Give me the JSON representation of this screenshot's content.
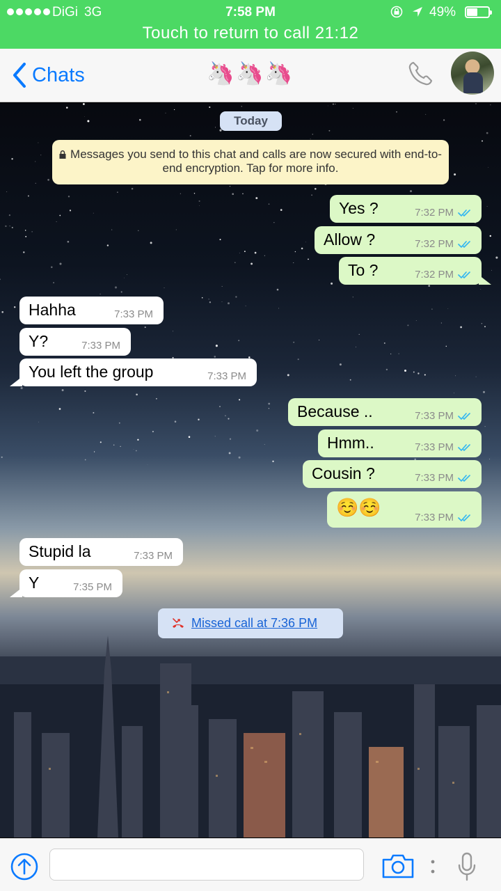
{
  "status_bar": {
    "carrier": "DiGi",
    "network": "3G",
    "time": "7:58 PM",
    "battery": "49%",
    "battery_level": 0.49
  },
  "call_banner": "Touch to return to call 21:12",
  "nav": {
    "back_label": "Chats",
    "title": "🦄🦄🦄"
  },
  "date_pill": "Today",
  "encryption_notice": "Messages you send to this chat and calls are now secured with end-to-end encryption. Tap for more info.",
  "messages": [
    {
      "dir": "out",
      "text": "Yes ?",
      "time": "7:32 PM"
    },
    {
      "dir": "out",
      "text": "Allow ?",
      "time": "7:32 PM"
    },
    {
      "dir": "out",
      "text": "To ?",
      "time": "7:32 PM"
    },
    {
      "dir": "in",
      "text": "Hahha",
      "time": "7:33 PM"
    },
    {
      "dir": "in",
      "text": "Y?",
      "time": "7:33 PM"
    },
    {
      "dir": "in",
      "text": "You left the group",
      "time": "7:33 PM"
    },
    {
      "dir": "out",
      "text": "Because ..",
      "time": "7:33 PM"
    },
    {
      "dir": "out",
      "text": "Hmm..",
      "time": "7:33 PM"
    },
    {
      "dir": "out",
      "text": "Cousin ?",
      "time": "7:33 PM"
    },
    {
      "dir": "out",
      "text": "☺️☺️",
      "time": "7:33 PM"
    },
    {
      "dir": "in",
      "text": "Stupid la",
      "time": "7:33 PM"
    },
    {
      "dir": "in",
      "text": "Y",
      "time": "7:35 PM"
    }
  ],
  "missed_call": "Missed call at 7:36 PM",
  "colors": {
    "accent": "#0a7aff",
    "call_bar": "#4cd964",
    "outgoing_bubble": "#dcf8c6",
    "incoming_bubble": "#ffffff",
    "read_ticks": "#34b7f1"
  },
  "icons": {
    "back": "chevron-left-icon",
    "phone": "phone-icon",
    "share": "share-arrow-icon",
    "camera": "camera-icon",
    "mic": "microphone-icon",
    "missed_call": "missed-call-icon"
  }
}
